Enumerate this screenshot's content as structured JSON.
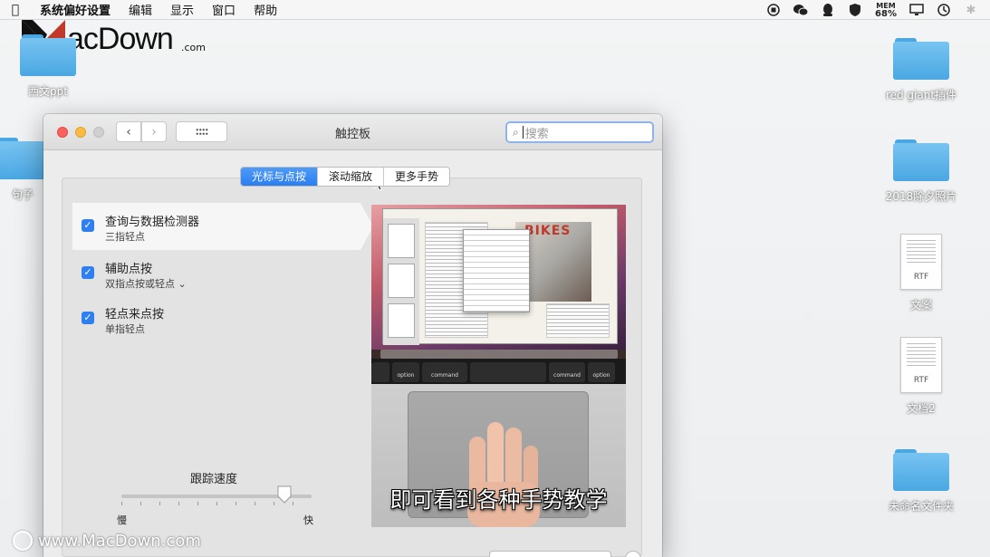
{
  "menubar": {
    "app": "系统偏好设置",
    "items": [
      "编辑",
      "显示",
      "窗口",
      "帮助"
    ],
    "mem_label": "MEM",
    "mem_value": "68%"
  },
  "logo": {
    "text": "acDown",
    "suffix": ".com"
  },
  "desktop": {
    "left_icons": [
      {
        "label": "西文ppt"
      },
      {
        "label": "句子"
      }
    ],
    "right_icons": [
      {
        "label": "red giant插件",
        "kind": "folder"
      },
      {
        "label": "2018除夕照片",
        "kind": "folder"
      },
      {
        "label": "文案",
        "kind": "rtf",
        "ext": "RTF"
      },
      {
        "label": "文档2",
        "kind": "rtf",
        "ext": "RTF"
      },
      {
        "label": "未命名文件夹",
        "kind": "folder"
      }
    ]
  },
  "window": {
    "title": "触控板",
    "search_placeholder": "搜索",
    "tabs": [
      {
        "label": "光标与点按",
        "active": true
      },
      {
        "label": "滚动缩放",
        "active": false
      },
      {
        "label": "更多手势",
        "active": false
      }
    ],
    "options": [
      {
        "title": "查询与数据检测器",
        "subtitle": "三指轻点",
        "checked": true
      },
      {
        "title": "辅助点按",
        "subtitle": "双指点按或轻点 ⌄",
        "checked": true
      },
      {
        "title": "轻点来点按",
        "subtitle": "单指轻点",
        "checked": true
      }
    ],
    "tracking": {
      "label": "跟踪速度",
      "slow": "慢",
      "fast": "快",
      "value_fraction": 0.86
    },
    "preview": {
      "caption": "即可看到各种手势教学",
      "brand_text": "BIKES",
      "keys": {
        "left_option": "option",
        "left_command": "command",
        "right_command": "command",
        "right_option": "option"
      }
    }
  },
  "watermark": {
    "text": "www.MacDown.com"
  },
  "colors": {
    "accent": "#2f7ff0",
    "folder": "#5ab3ea"
  }
}
